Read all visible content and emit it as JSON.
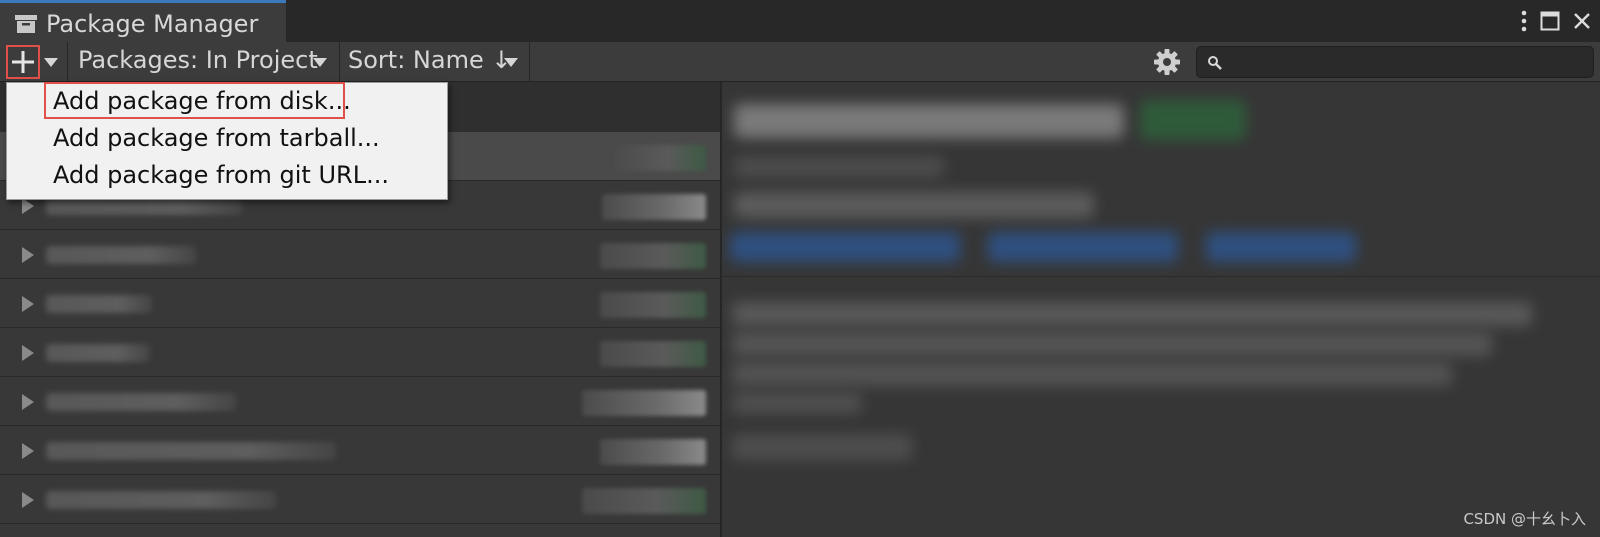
{
  "window": {
    "title": "Package Manager",
    "controls": [
      "more-options-icon",
      "maximize-icon",
      "close-icon"
    ]
  },
  "toolbar": {
    "add_icon": "plus-icon",
    "packages_filter": "Packages: In Project",
    "sort": "Sort: Name ↓",
    "settings_icon": "gear-icon",
    "search": {
      "value": "",
      "placeholder": "",
      "icon": "search-icon"
    }
  },
  "add_menu": {
    "items": [
      {
        "label": "Add package from disk...",
        "highlighted": true
      },
      {
        "label": "Add package from tarball..."
      },
      {
        "label": "Add package from git URL..."
      }
    ]
  },
  "package_list": {
    "row_count": 8,
    "selected_index": 0,
    "content_obscured": true
  },
  "details": {
    "content_obscured": true
  },
  "colors": {
    "highlight_box": "#e0504a",
    "tab_accent": "#3a79bb",
    "background": "#383838",
    "menu_bg": "#f1f1f1"
  },
  "watermark": "CSDN @十幺卜入"
}
